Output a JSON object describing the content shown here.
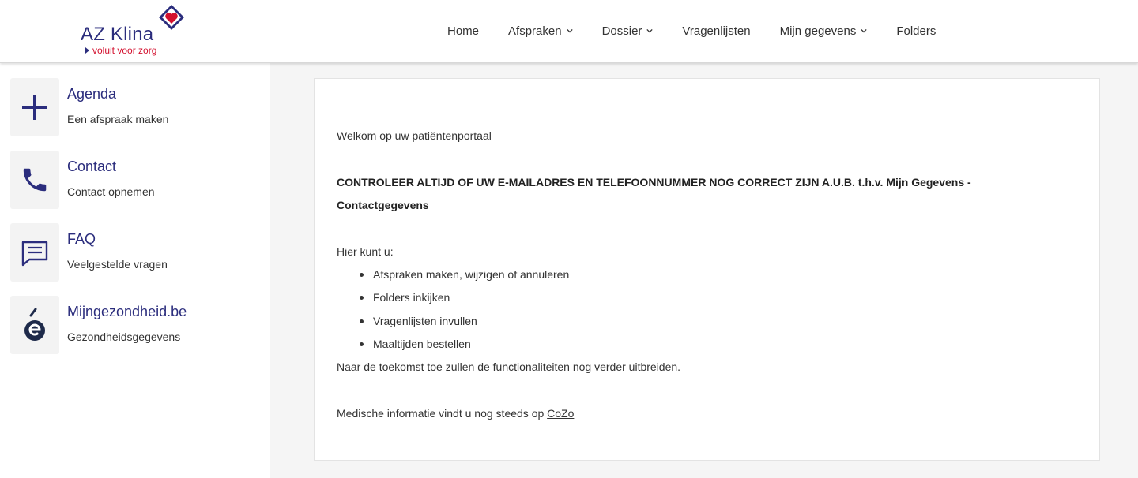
{
  "brand": {
    "name": "AZ Klina",
    "tagline": "voluit voor zorg",
    "color_primary": "#2b2d7d",
    "color_accent": "#d3102e"
  },
  "nav": {
    "items": [
      {
        "label": "Home",
        "dropdown": false
      },
      {
        "label": "Afspraken",
        "dropdown": true
      },
      {
        "label": "Dossier",
        "dropdown": true
      },
      {
        "label": "Vragenlijsten",
        "dropdown": false
      },
      {
        "label": "Mijn gegevens",
        "dropdown": true
      },
      {
        "label": "Folders",
        "dropdown": false
      }
    ]
  },
  "sidebar": {
    "items": [
      {
        "title": "Agenda",
        "subtitle": "Een afspraak maken",
        "icon": "plus-icon"
      },
      {
        "title": "Contact",
        "subtitle": "Contact opnemen",
        "icon": "phone-icon"
      },
      {
        "title": "FAQ",
        "subtitle": "Veelgestelde vragen",
        "icon": "chat-icon"
      },
      {
        "title": "Mijngezondheid.be",
        "subtitle": "Gezondheidsgegevens",
        "icon": "mijngezondheid-icon"
      }
    ]
  },
  "main": {
    "welcome": "Welkom op uw patiëntenportaal",
    "warning": "CONTROLEER ALTIJD OF UW E-MAILADRES EN TELEFOONNUMMER NOG CORRECT ZIJN A.U.B. t.h.v. Mijn Gegevens - Contactgegevens",
    "intro": "Hier kunt u:",
    "bullets": [
      "Afspraken maken, wijzigen of annuleren",
      "Folders inkijken",
      "Vragenlijsten invullen",
      "Maaltijden bestellen"
    ],
    "future": "Naar de toekomst toe zullen de functionaliteiten nog verder uitbreiden.",
    "medical_prefix": "Medische informatie vindt u nog steeds op ",
    "medical_link": "CoZo"
  }
}
